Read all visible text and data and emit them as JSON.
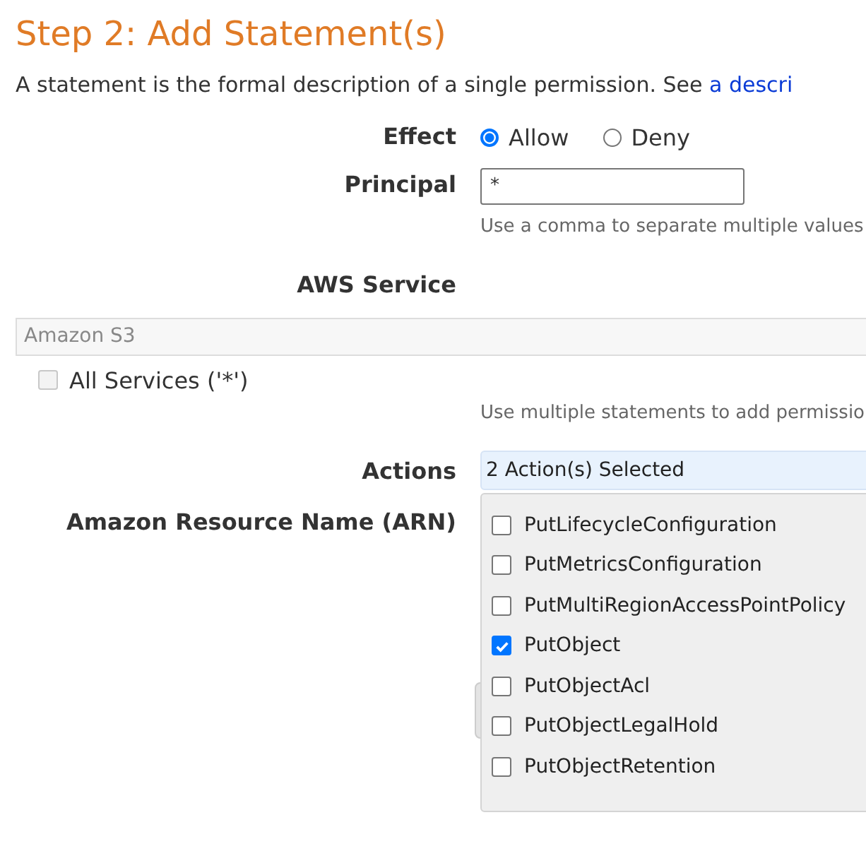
{
  "title": "Step 2: Add Statement(s)",
  "intro": {
    "text": "A statement is the formal description of a single permission. See",
    "link": "a descri"
  },
  "effect": {
    "label": "Effect",
    "options": [
      {
        "label": "Allow",
        "selected": true
      },
      {
        "label": "Deny",
        "selected": false
      }
    ]
  },
  "principal": {
    "label": "Principal",
    "value": "*",
    "hint": "Use a comma to separate multiple values"
  },
  "service": {
    "label": "AWS Service",
    "value": "Amazon S3",
    "all_services": {
      "label": "All Services ('*')",
      "checked": false
    },
    "hint": "Use multiple statements to add permissio"
  },
  "actions": {
    "label": "Actions",
    "value": "2 Action(s) Selected",
    "options": [
      {
        "label": "PutLifecycleConfiguration",
        "checked": false
      },
      {
        "label": "PutMetricsConfiguration",
        "checked": false
      },
      {
        "label": "PutMultiRegionAccessPointPolicy",
        "checked": false
      },
      {
        "label": "PutObject",
        "checked": true
      },
      {
        "label": "PutObjectAcl",
        "checked": false
      },
      {
        "label": "PutObjectLegalHold",
        "checked": false
      },
      {
        "label": "PutObjectRetention",
        "checked": false
      }
    ]
  },
  "arn": {
    "label": "Amazon Resource Name (ARN)"
  }
}
